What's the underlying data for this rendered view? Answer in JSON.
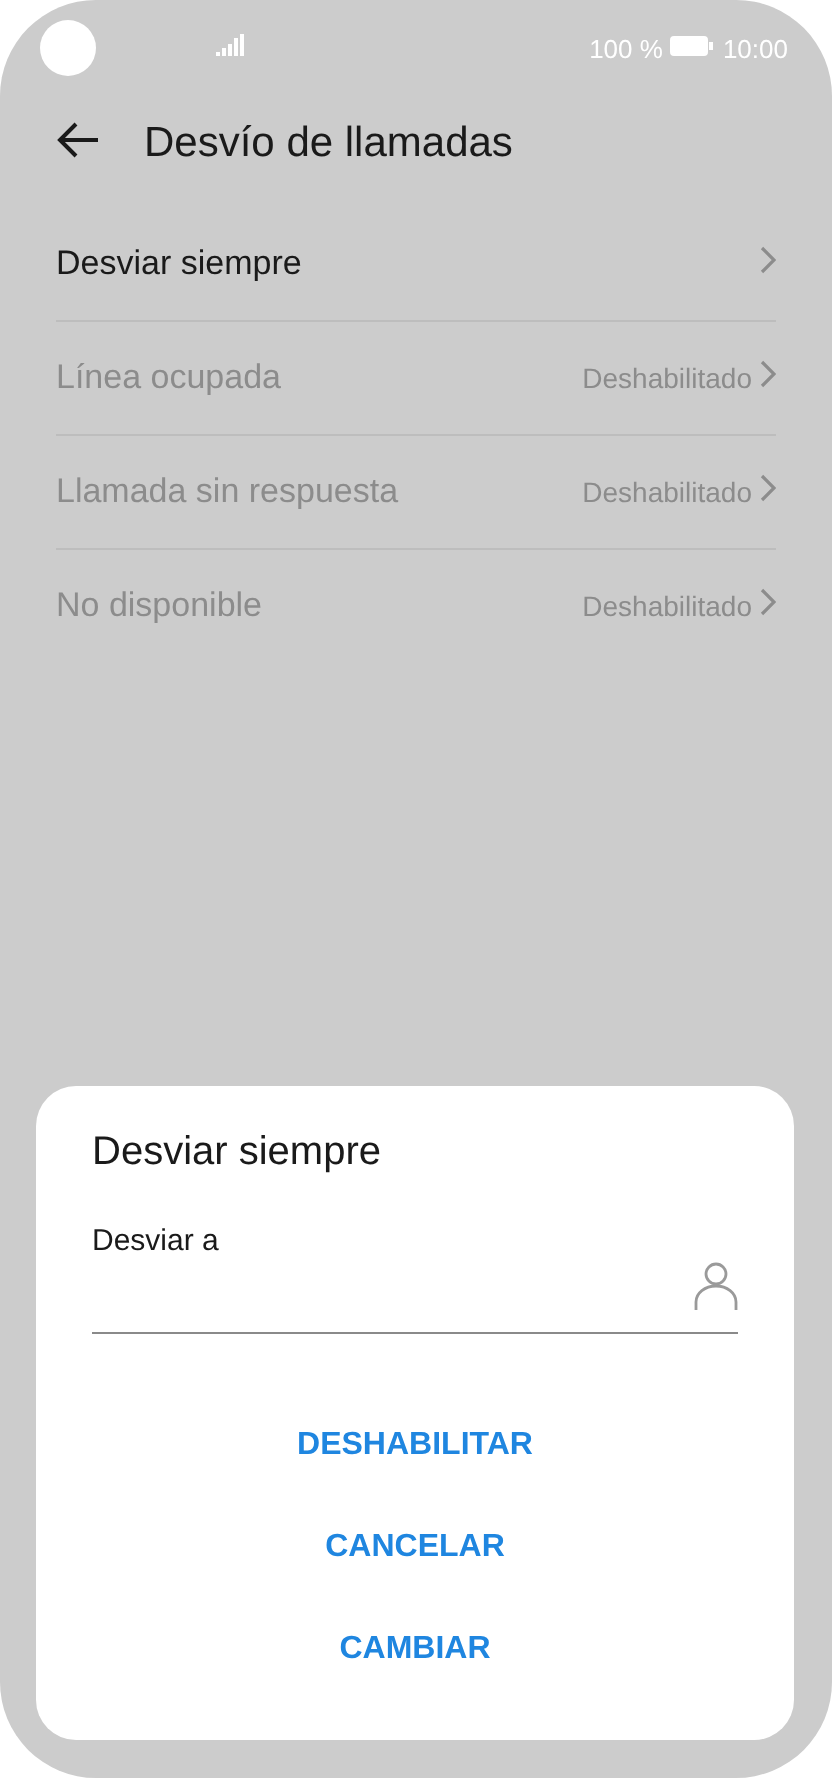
{
  "status_bar": {
    "battery": "100 %",
    "time": "10:00"
  },
  "header": {
    "title": "Desvío de llamadas"
  },
  "items": [
    {
      "label": "Desviar siempre",
      "disabled": false
    },
    {
      "label": "Línea ocupada",
      "value": "Deshabilitado",
      "disabled": true
    },
    {
      "label": "Llamada sin respuesta",
      "value": "Deshabilitado",
      "disabled": true
    },
    {
      "label": "No disponible",
      "value": "Deshabilitado",
      "disabled": true
    }
  ],
  "dialog": {
    "title": "Desviar siempre",
    "field_label": "Desviar a",
    "buttons": [
      "DESHABILITAR",
      "CANCELAR",
      "CAMBIAR"
    ]
  }
}
